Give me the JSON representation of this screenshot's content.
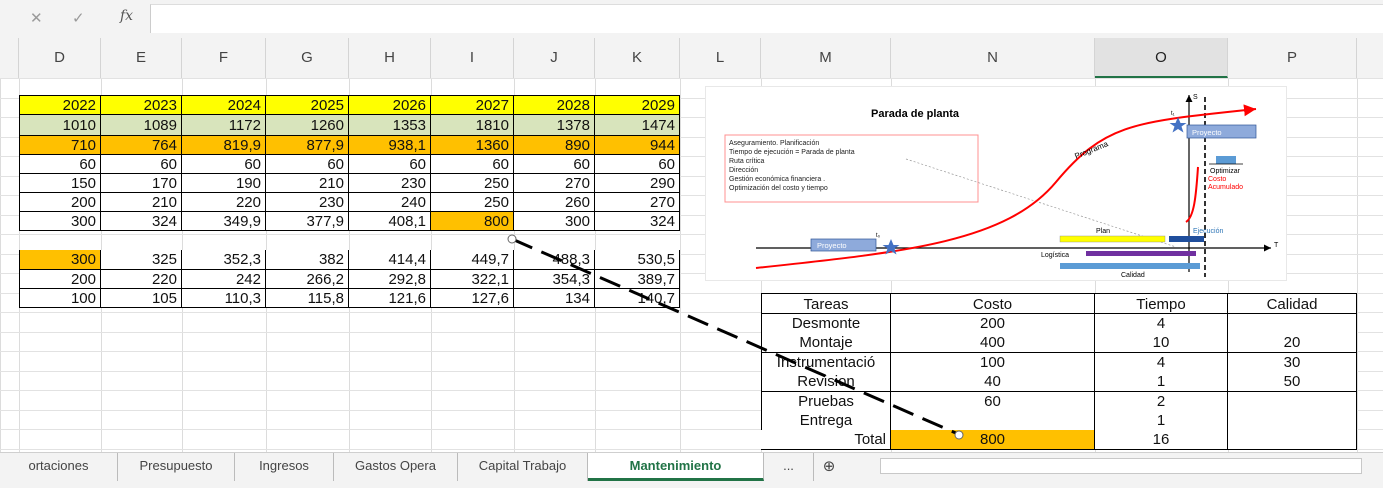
{
  "formula_bar": {
    "cancel_glyph": "✕",
    "enter_glyph": "✓",
    "fx_label": "fx"
  },
  "columns": [
    "D",
    "E",
    "F",
    "G",
    "H",
    "I",
    "J",
    "K",
    "L",
    "M",
    "N",
    "O",
    "P"
  ],
  "main_table": {
    "years": [
      "2022",
      "2023",
      "2024",
      "2025",
      "2026",
      "2027",
      "2028",
      "2029"
    ],
    "rows": [
      [
        "1010",
        "1089",
        "1172",
        "1260",
        "1353",
        "1810",
        "1378",
        "1474"
      ],
      [
        "710",
        "764",
        "819,9",
        "877,9",
        "938,1",
        "1360",
        "890",
        "944"
      ],
      [
        "60",
        "60",
        "60",
        "60",
        "60",
        "60",
        "60",
        "60"
      ],
      [
        "150",
        "170",
        "190",
        "210",
        "230",
        "250",
        "270",
        "290"
      ],
      [
        "200",
        "210",
        "220",
        "230",
        "240",
        "250",
        "260",
        "270"
      ],
      [
        "300",
        "324",
        "349,9",
        "377,9",
        "408,1",
        "800",
        "300",
        "324"
      ],
      [
        "",
        "",
        "",
        "",
        "",
        "",
        "",
        ""
      ],
      [
        "300",
        "325",
        "352,3",
        "382",
        "414,4",
        "449,7",
        "488,3",
        "530,5"
      ],
      [
        "200",
        "220",
        "242",
        "266,2",
        "292,8",
        "322,1",
        "354,3",
        "389,7"
      ],
      [
        "100",
        "105",
        "110,3",
        "115,8",
        "121,6",
        "127,6",
        "134",
        "140,7"
      ]
    ]
  },
  "tasks_table": {
    "headers": [
      "Tareas",
      "Costo",
      "Tiempo",
      "Calidad"
    ],
    "rows": [
      [
        "Desmonte",
        "200",
        "4",
        ""
      ],
      [
        "Montaje",
        "400",
        "10",
        "20"
      ],
      [
        "Instrumentació",
        "100",
        "4",
        "30"
      ],
      [
        "Revision",
        "40",
        "1",
        "50"
      ],
      [
        "Pruebas",
        "60",
        "2",
        ""
      ],
      [
        "Entrega",
        "",
        "1",
        ""
      ]
    ],
    "total_label": "Total",
    "total_cost": "800",
    "total_time": "16"
  },
  "picture": {
    "title": "Parada de planta",
    "legend_lines": [
      "Aseguramiento. Planificación",
      "Tiempo de ejecución = Parada de planta",
      "Ruta crítica",
      "Dirección",
      "Gestión económica financiera  .",
      "Optimización del costo y tiempo"
    ],
    "proyecto_top": "Proyecto",
    "proyecto_left": "Proyecto",
    "programa": "Programa",
    "optimizar": "Optimizar",
    "costo_acumulado_1": "Costo",
    "costo_acumulado_2": "Acumulado",
    "plan": "Plan",
    "ejecucion": "Ejecución",
    "logistica": "Logística",
    "calidad": "Calidad",
    "axis_s": "S",
    "axis_t": "T",
    "t0": "t₀",
    "t1": "t₁"
  },
  "sheet_tabs": [
    "ortaciones",
    "Presupuesto",
    "Ingresos",
    "Gastos Opera",
    "Capital Trabajo",
    "Mantenimiento",
    "..."
  ],
  "active_tab": "Mantenimiento",
  "add_sheet_glyph": "⊕",
  "colors": {
    "yellow": "#FFFF00",
    "orange": "#FFC000",
    "green": "#D8E4BC",
    "accent": "#217346",
    "star": "#4472C4",
    "curve": "#FF0000"
  }
}
